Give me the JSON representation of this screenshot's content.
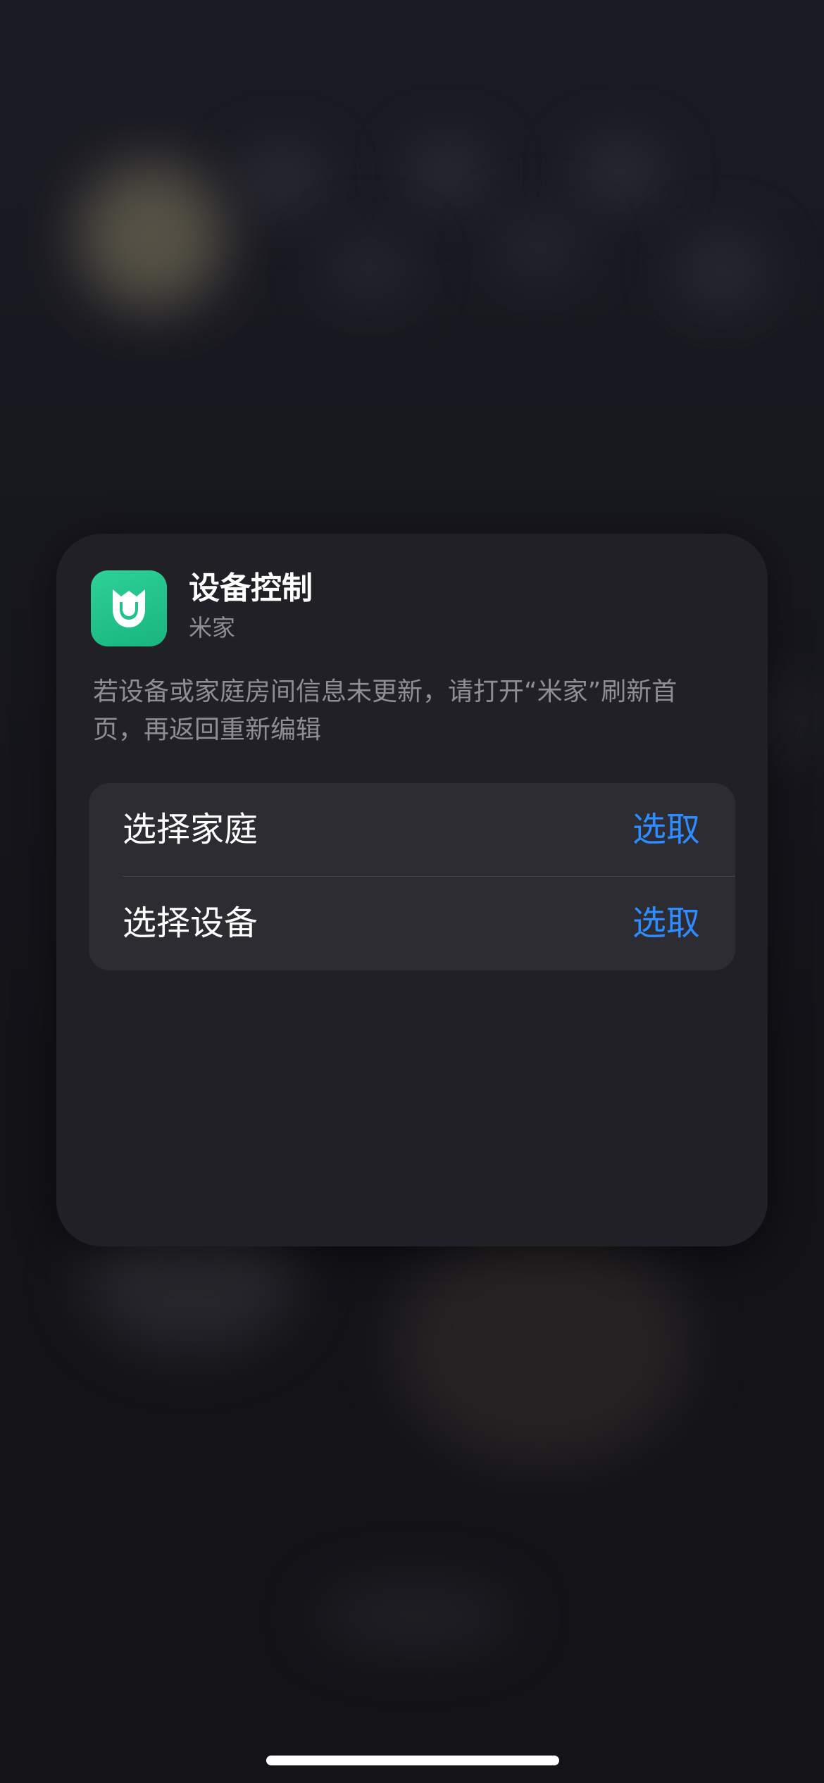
{
  "widget": {
    "icon": "mijia-app-icon",
    "title": "设备控制",
    "subtitle": "米家",
    "description": "若设备或家庭房间信息未更新，请打开“米家”刷新首页，再返回重新编辑",
    "options": [
      {
        "label": "选择家庭",
        "action": "选取"
      },
      {
        "label": "选择设备",
        "action": "选取"
      }
    ]
  },
  "colors": {
    "accent": "#2d8cff",
    "app_icon": "#1fc28a",
    "sheet_background": "#212026"
  }
}
